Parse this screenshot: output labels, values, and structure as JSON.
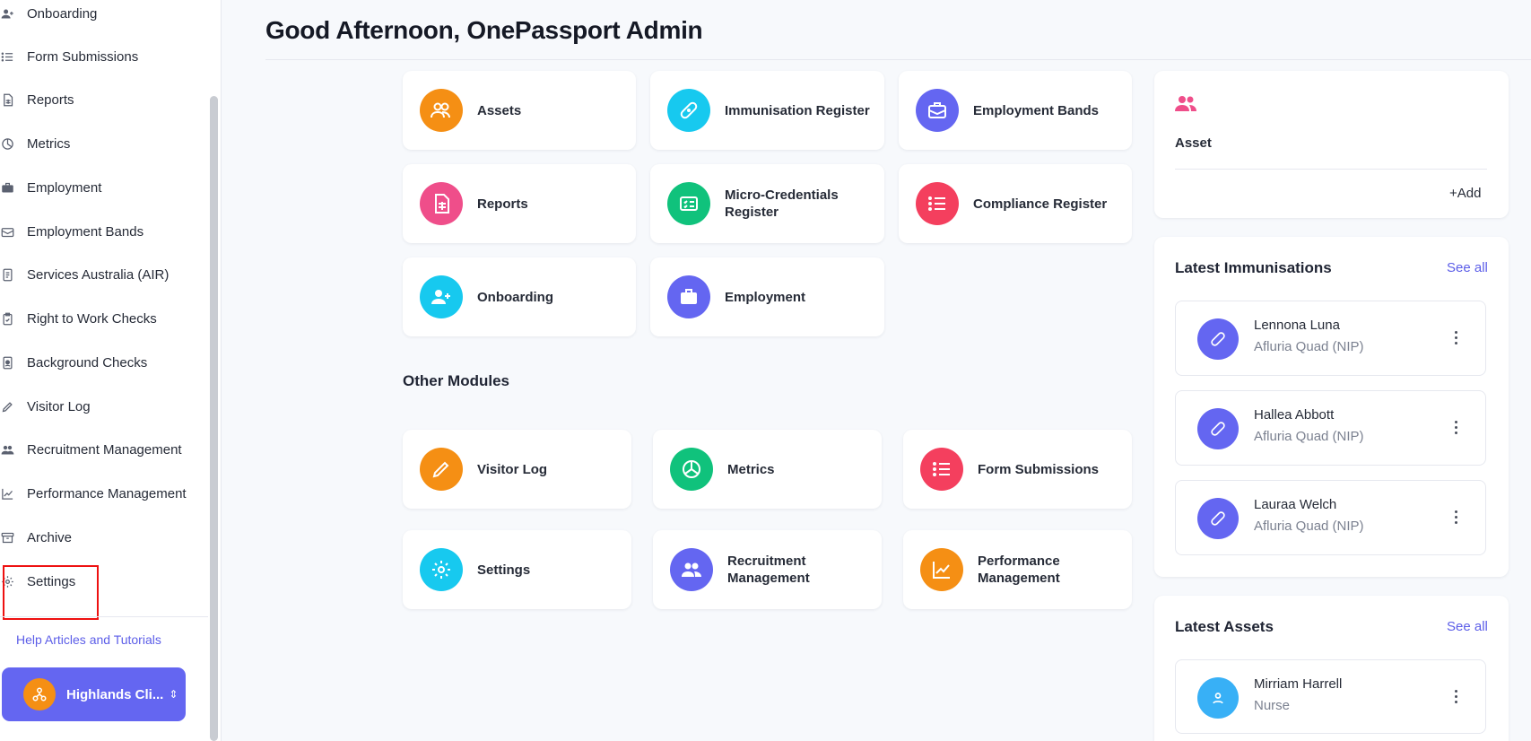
{
  "sidebar": {
    "items": [
      {
        "label": "Onboarding",
        "icon": "user-plus-icon"
      },
      {
        "label": "Form Submissions",
        "icon": "list-icon"
      },
      {
        "label": "Reports",
        "icon": "report-icon"
      },
      {
        "label": "Metrics",
        "icon": "pie-chart-icon"
      },
      {
        "label": "Employment",
        "icon": "briefcase-icon"
      },
      {
        "label": "Employment Bands",
        "icon": "envelope-icon"
      },
      {
        "label": "Services Australia (AIR)",
        "icon": "document-icon"
      },
      {
        "label": "Right to Work Checks",
        "icon": "clipboard-check-icon"
      },
      {
        "label": "Background Checks",
        "icon": "id-badge-icon"
      },
      {
        "label": "Visitor Log",
        "icon": "pencil-icon"
      },
      {
        "label": "Recruitment Management",
        "icon": "users-icon"
      },
      {
        "label": "Performance Management",
        "icon": "trend-chart-icon"
      },
      {
        "label": "Archive",
        "icon": "archive-icon"
      },
      {
        "label": "Settings",
        "icon": "gear-icon"
      }
    ],
    "help_link": "Help Articles and Tutorials",
    "org_name": "Highlands Cli..."
  },
  "header": {
    "greeting": "Good Afternoon, OnePassport Admin"
  },
  "modules": [
    {
      "label": "Assets",
      "color": "#f58f14",
      "icon": "users-icon"
    },
    {
      "label": "Immunisation Register",
      "color": "#17c9ef",
      "icon": "bandage-icon"
    },
    {
      "label": "Employment Bands",
      "color": "#6466f1",
      "icon": "briefcase-icon"
    },
    {
      "label": "Reports",
      "color": "#ef4e8a",
      "icon": "report-icon"
    },
    {
      "label": "Micro-Credentials Register",
      "color": "#10c27c",
      "icon": "credential-icon"
    },
    {
      "label": "Compliance Register",
      "color": "#f43f5e",
      "icon": "list-icon"
    },
    {
      "label": "Onboarding",
      "color": "#17c9ef",
      "icon": "user-plus-icon"
    },
    {
      "label": "Employment",
      "color": "#6466f1",
      "icon": "briefcase-icon"
    }
  ],
  "other_modules": {
    "title": "Other Modules",
    "items": [
      {
        "label": "Visitor Log",
        "color": "#f58f14",
        "icon": "pencil-icon"
      },
      {
        "label": "Metrics",
        "color": "#10c27c",
        "icon": "pie-chart-icon"
      },
      {
        "label": "Form Submissions",
        "color": "#f43f5e",
        "icon": "list-icon"
      },
      {
        "label": "Settings",
        "color": "#17c9ef",
        "icon": "gear-icon"
      },
      {
        "label": "Recruitment Management",
        "color": "#6466f1",
        "icon": "users-icon"
      },
      {
        "label": "Performance Management",
        "color": "#f58f14",
        "icon": "trend-chart-icon"
      }
    ]
  },
  "asset_panel": {
    "label": "Asset",
    "add_label": "Add",
    "color": "#ef4e8a"
  },
  "latest_immunisations": {
    "title": "Latest Immunisations",
    "see_all": "See all",
    "items": [
      {
        "name": "Lennona Luna",
        "sub": "Afluria Quad (NIP)"
      },
      {
        "name": "Hallea Abbott",
        "sub": "Afluria Quad (NIP)"
      },
      {
        "name": "Lauraa Welch",
        "sub": "Afluria Quad (NIP)"
      }
    ],
    "color": "#6466f1"
  },
  "latest_assets": {
    "title": "Latest Assets",
    "see_all": "See all",
    "items": [
      {
        "name": "Mirriam Harrell",
        "sub": "Nurse"
      }
    ],
    "color": "#38b0f6"
  }
}
